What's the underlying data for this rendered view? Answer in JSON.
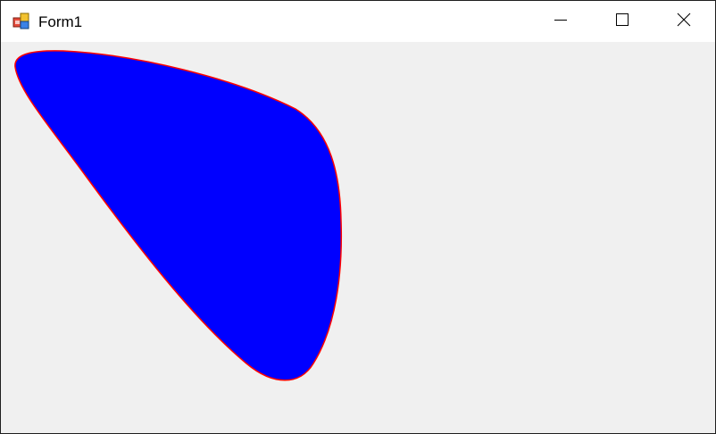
{
  "window": {
    "title": "Form1"
  },
  "titlebar_buttons": {
    "minimize_icon": "minimize-icon",
    "maximize_icon": "maximize-icon",
    "close_icon": "close-icon"
  },
  "shape": {
    "fill": "#0000ff",
    "stroke": "#ff0000"
  },
  "colors": {
    "client_background": "#f0f0f0",
    "titlebar_background": "#ffffff"
  }
}
